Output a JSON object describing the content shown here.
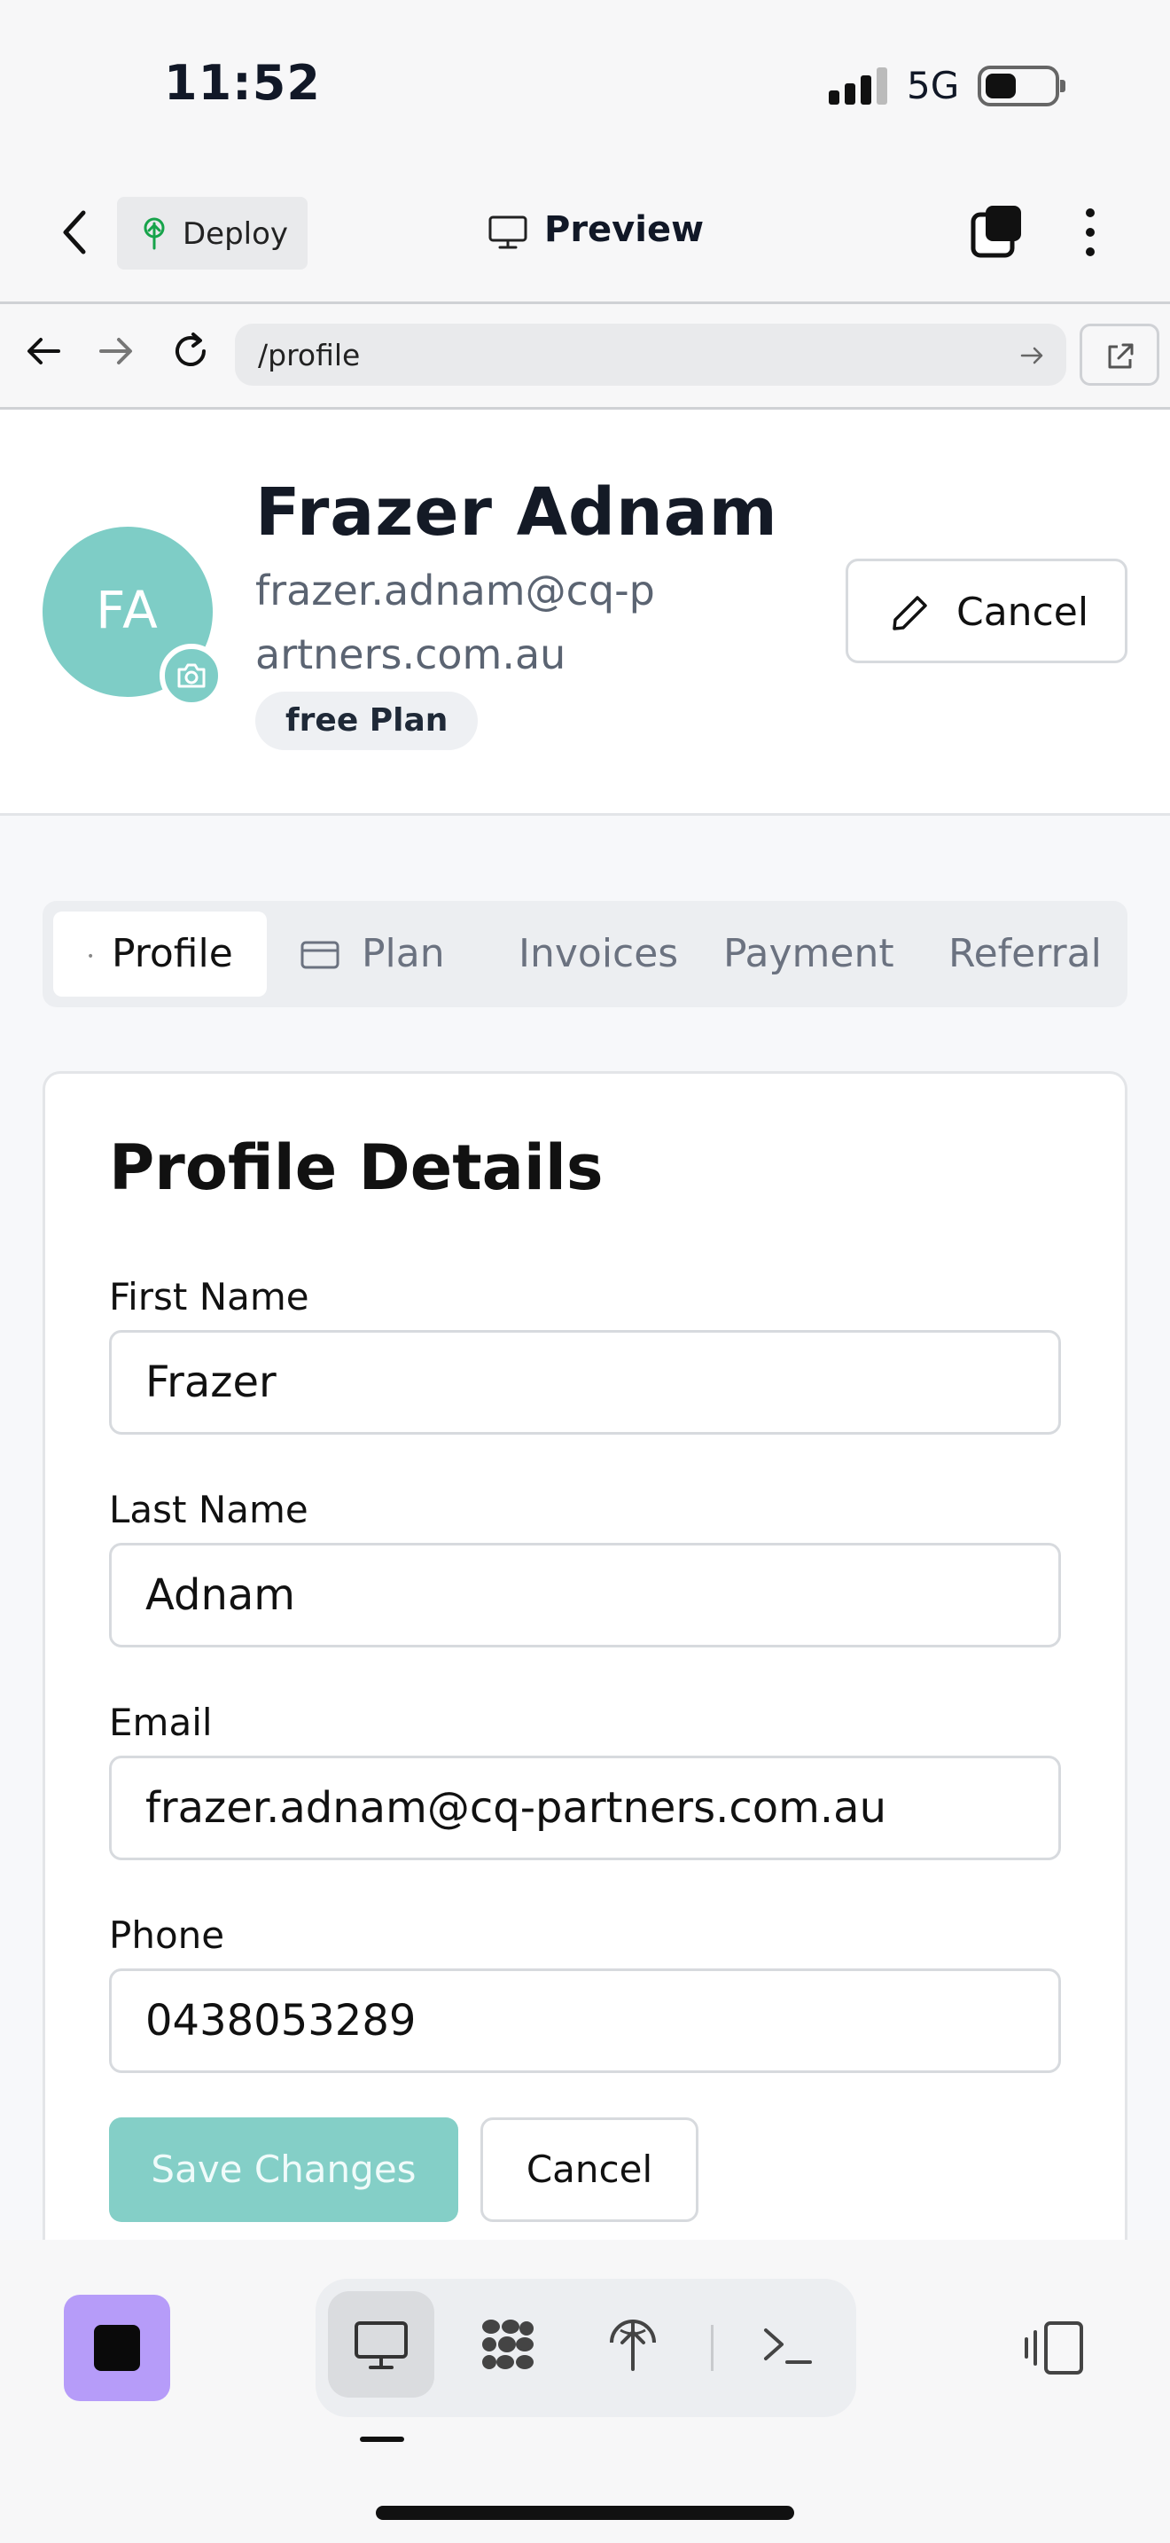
{
  "status_bar": {
    "time": "11:52",
    "network": "5G"
  },
  "header": {
    "deploy_label": "Deploy",
    "preview_label": "Preview"
  },
  "browser": {
    "url": "/profile"
  },
  "profile": {
    "initials": "FA",
    "name": "Frazer Adnam",
    "email": "frazer.adnam@cq-partners.com.au",
    "plan_badge": "free Plan",
    "edit_cancel_label": "Cancel"
  },
  "tabs": [
    {
      "label": "Profile",
      "active": true
    },
    {
      "label": "Plan",
      "active": false
    },
    {
      "label": "Invoices",
      "active": false
    },
    {
      "label": "Payment",
      "active": false
    },
    {
      "label": "Referral",
      "active": false
    }
  ],
  "form": {
    "title": "Profile Details",
    "fields": [
      {
        "label": "First Name",
        "value": "Frazer"
      },
      {
        "label": "Last Name",
        "value": "Adnam"
      },
      {
        "label": "Email",
        "value": "frazer.adnam@cq-partners.com.au"
      },
      {
        "label": "Phone",
        "value": "0438053289"
      }
    ],
    "save_label": "Save Changes",
    "cancel_label": "Cancel"
  },
  "toolbar": {
    "tools": [
      "desktop-icon",
      "apps-icon",
      "deploy-icon",
      "terminal-icon"
    ],
    "active_tool": "desktop-icon"
  },
  "colors": {
    "accent": "#84cfc7",
    "avatar": "#7ecdc6",
    "stop_button": "#b69cf9"
  }
}
